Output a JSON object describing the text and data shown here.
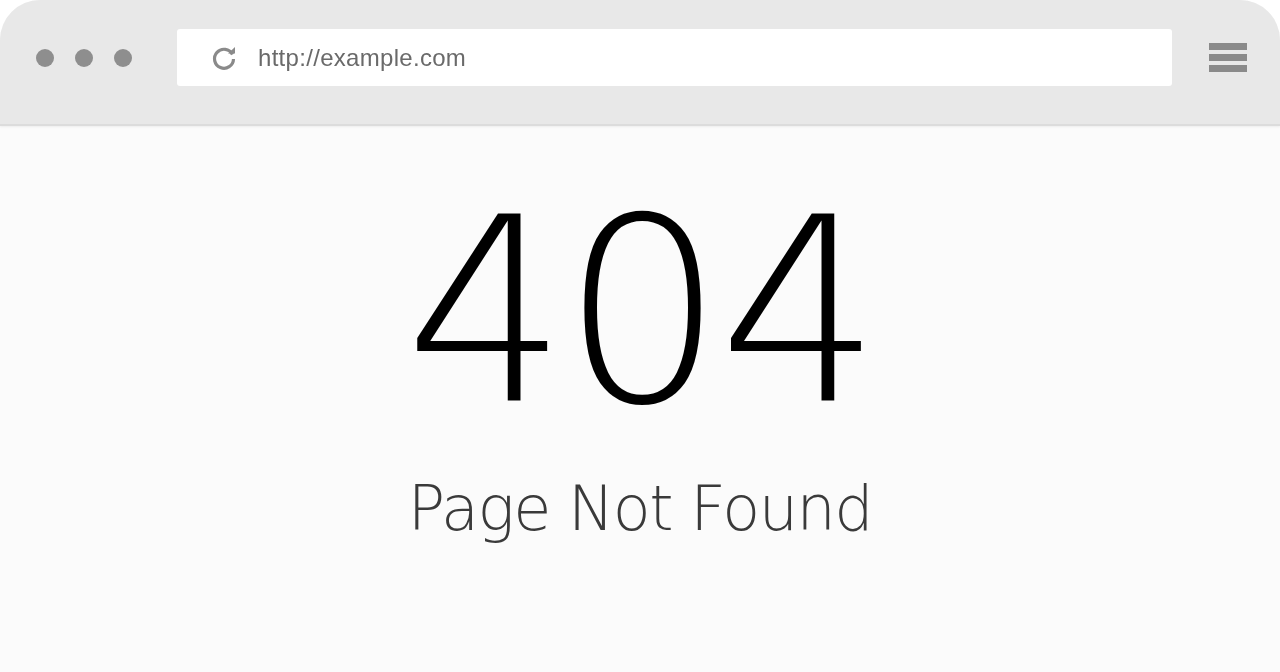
{
  "browser": {
    "window_buttons": [
      {
        "kind": "dot"
      },
      {
        "kind": "dot"
      },
      {
        "kind": "dot"
      }
    ],
    "url": "http://example.com"
  },
  "error_page": {
    "code": "404",
    "message": "Page Not Found"
  }
}
